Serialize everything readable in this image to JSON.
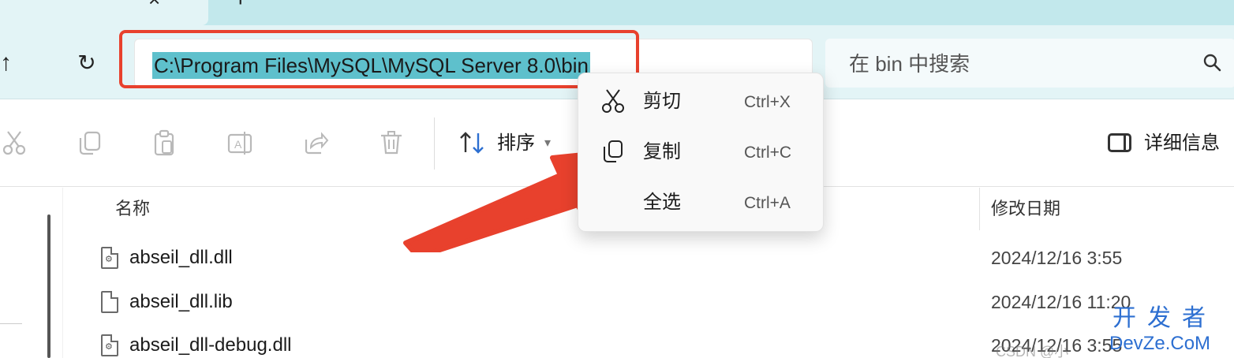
{
  "tabs": {
    "close_glyph": "×",
    "new_glyph": "+"
  },
  "nav": {
    "up_glyph": "↑",
    "refresh_glyph": "↻"
  },
  "address": {
    "path": "C:\\Program Files\\MySQL\\MySQL Server 8.0\\bin",
    "selected": true
  },
  "search": {
    "placeholder": "在 bin 中搜索",
    "icon": "search-icon"
  },
  "toolbar": {
    "sort_label": "排序",
    "details_label": "详细信息",
    "icons": [
      "cut-icon",
      "copy-icon",
      "paste-icon",
      "rename-icon",
      "share-icon",
      "delete-icon"
    ]
  },
  "columns": {
    "name": "名称",
    "date_modified": "修改日期"
  },
  "files": [
    {
      "name": "abseil_dll.dll",
      "date": "2024/12/16 3:55",
      "icon": "dll-file-icon"
    },
    {
      "name": "abseil_dll.lib",
      "date": "2024/12/16 11:20",
      "icon": "file-icon"
    },
    {
      "name": "abseil_dll-debug.dll",
      "date": "2024/12/16 3:55",
      "icon": "dll-file-icon"
    }
  ],
  "context_menu": {
    "items": [
      {
        "label": "剪切",
        "shortcut": "Ctrl+X",
        "icon": "cut-icon"
      },
      {
        "label": "复制",
        "shortcut": "Ctrl+C",
        "icon": "copy-icon"
      },
      {
        "label": "全选",
        "shortcut": "Ctrl+A",
        "icon": ""
      }
    ]
  },
  "annotation": {
    "color": "#e8412d"
  },
  "watermark": {
    "csdn": "CSDN @小",
    "logo_zh": "开发者",
    "logo_en": "DevZe.CoM"
  },
  "colors": {
    "accent": "#5ec0cc",
    "tab_strip": "#c2e8ec",
    "address_bg": "#e3f4f6"
  }
}
